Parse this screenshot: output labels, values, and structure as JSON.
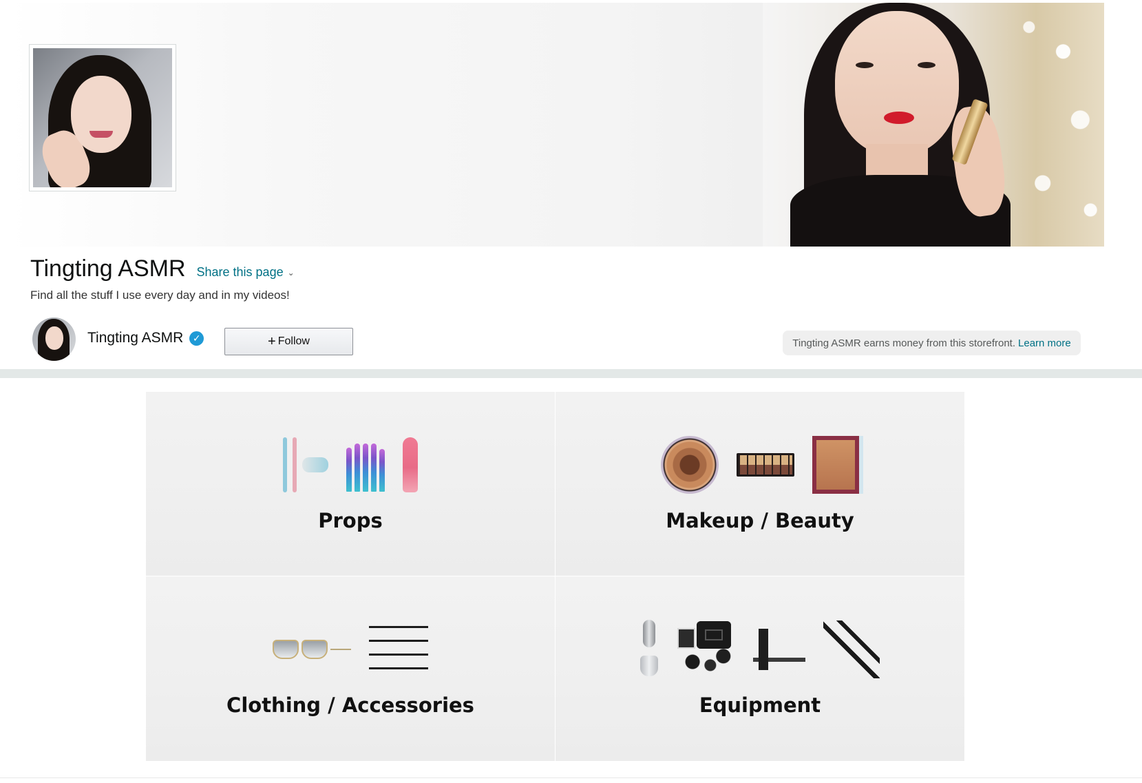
{
  "profile": {
    "title": "Tingting ASMR",
    "share_label": "Share this page",
    "description": "Find all the stuff I use every day and in my videos!",
    "owner_name": "Tingting ASMR",
    "follow_plus": "+",
    "follow_label": "Follow",
    "earnings_note": "Tingting ASMR earns money from this storefront.",
    "learn_more_label": "Learn more"
  },
  "categories": [
    {
      "label": "Props",
      "icons": [
        "toothbrush-icon",
        "makeup-brushes-icon",
        "hairbrush-icon"
      ]
    },
    {
      "label": "Makeup / Beauty",
      "icons": [
        "eyeshadow-compact-icon",
        "eyeshadow-palette-icon",
        "bronzer-icon"
      ]
    },
    {
      "label": "Clothing / Accessories",
      "icons": [
        "sunglasses-icon",
        "choker-set-icon"
      ]
    },
    {
      "label": "Equipment",
      "icons": [
        "usb-microphone-icon",
        "camera-kit-icon",
        "studio-microphone-icon",
        "xlr-cable-icon"
      ]
    }
  ],
  "colors": {
    "link": "#007185",
    "verified_badge": "#1f9ad6",
    "divider_band": "#e3e8e7",
    "tile_background": "#efefef"
  }
}
